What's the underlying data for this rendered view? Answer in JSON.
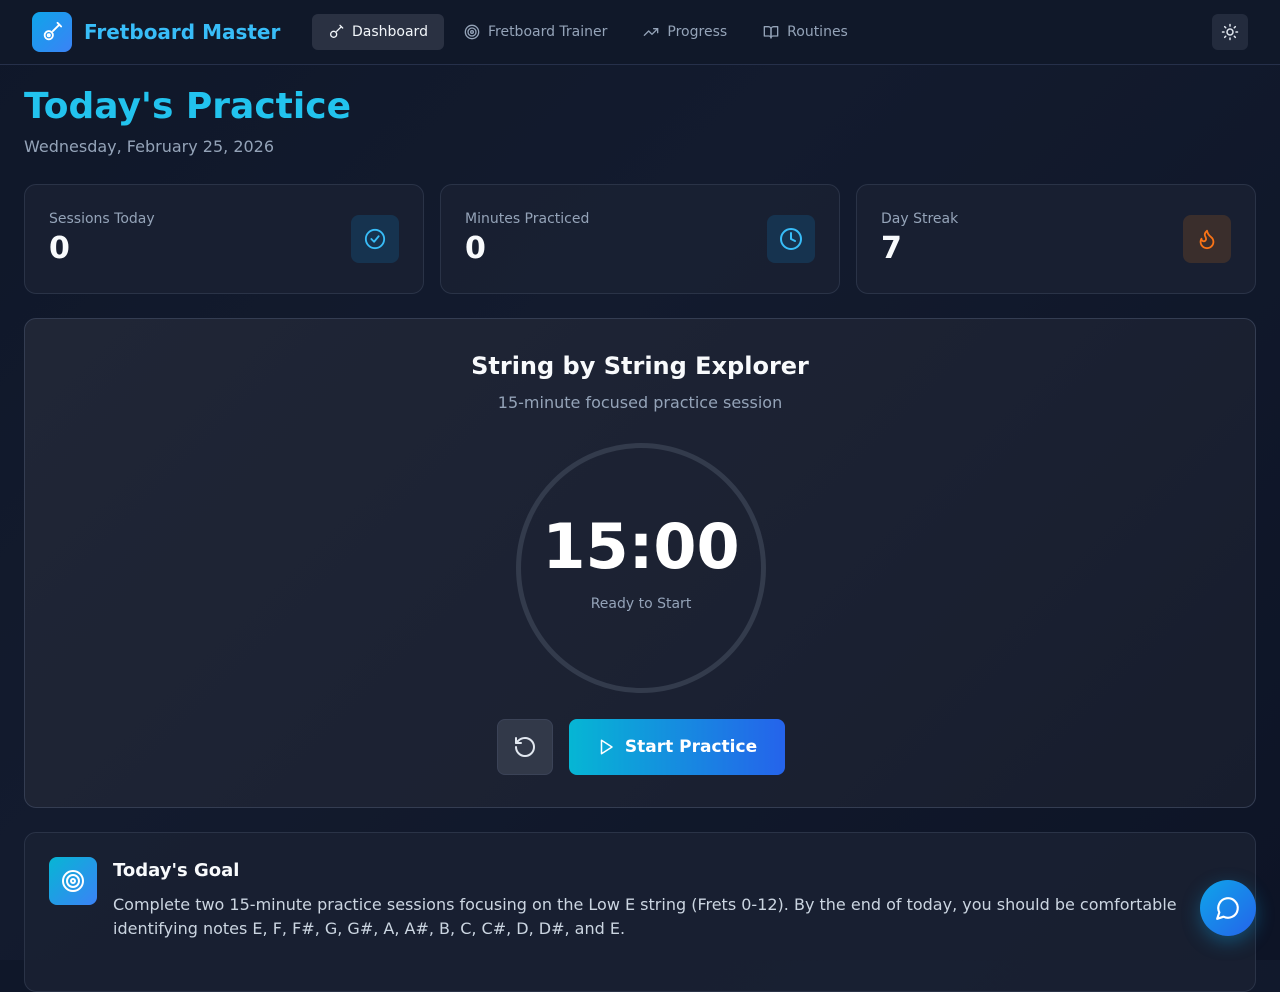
{
  "app": {
    "name": "Fretboard Master"
  },
  "nav": {
    "items": [
      {
        "label": "Dashboard",
        "icon": "guitar-icon",
        "active": true
      },
      {
        "label": "Fretboard Trainer",
        "icon": "target-icon",
        "active": false
      },
      {
        "label": "Progress",
        "icon": "trending-up-icon",
        "active": false
      },
      {
        "label": "Routines",
        "icon": "book-open-icon",
        "active": false
      }
    ],
    "theme_toggle_icon": "sun-icon"
  },
  "header": {
    "title": "Today's Practice",
    "date": "Wednesday, February 25, 2026"
  },
  "stats": [
    {
      "label": "Sessions Today",
      "value": "0",
      "icon": "check-circle-icon",
      "color": "#38bdf8"
    },
    {
      "label": "Minutes Practiced",
      "value": "0",
      "icon": "clock-icon",
      "color": "#38bdf8"
    },
    {
      "label": "Day Streak",
      "value": "7",
      "icon": "flame-icon",
      "color": "#f97316"
    }
  ],
  "session": {
    "title": "String by String Explorer",
    "subtitle": "15-minute focused practice session",
    "timer": "15:00",
    "status": "Ready to Start",
    "start_label": "Start Practice",
    "reset_icon": "rotate-ccw-icon"
  },
  "goal": {
    "title": "Today's Goal",
    "text": "Complete two 15-minute practice sessions focusing on the Low E string (Frets 0-12). By the end of today, you should be comfortable identifying notes E, F, F#, G, G#, A, A#, B, C, C#, D, D#, and E.",
    "icon": "target-icon"
  },
  "chat": {
    "icon": "message-circle-icon"
  },
  "colors": {
    "accent": "#22c3ee",
    "primary_gradient_start": "#06b6d4",
    "primary_gradient_end": "#2563eb",
    "streak": "#f97316"
  }
}
